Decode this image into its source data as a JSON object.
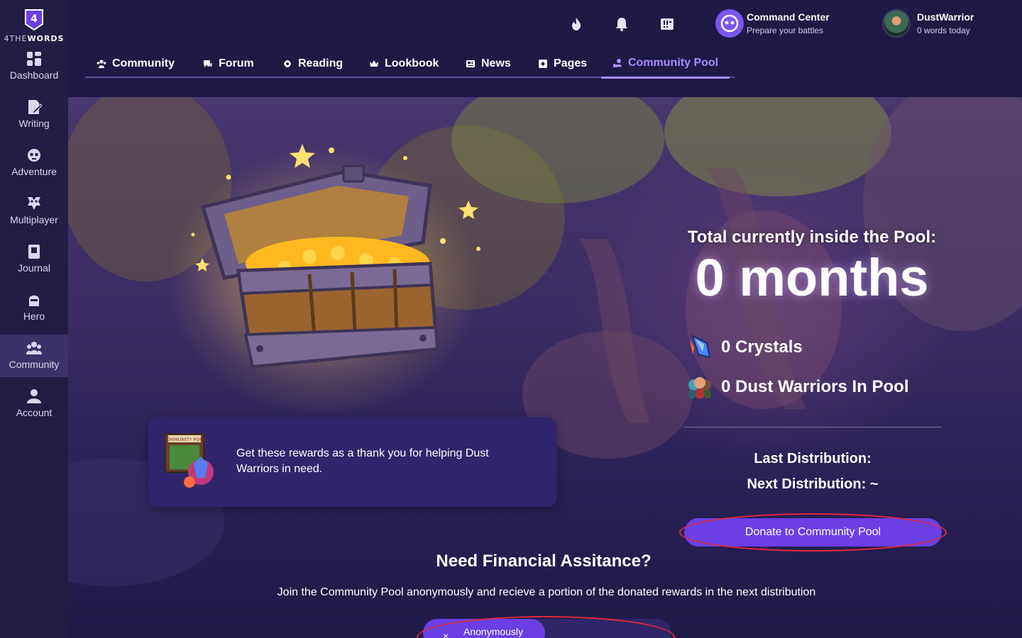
{
  "brand": {
    "name": "4THEWORDS",
    "name_prefix": "4THE",
    "name_suffix": "WORDS",
    "badge_number": "4"
  },
  "sidebar": {
    "items": [
      {
        "label": "Dashboard",
        "icon": "dashboard-icon"
      },
      {
        "label": "Writing",
        "icon": "writing-icon"
      },
      {
        "label": "Adventure",
        "icon": "adventure-icon"
      },
      {
        "label": "Multiplayer",
        "icon": "multiplayer-icon"
      },
      {
        "label": "Journal",
        "icon": "journal-icon"
      },
      {
        "label": "Hero",
        "icon": "hero-icon"
      },
      {
        "label": "Community",
        "icon": "community-icon",
        "active": true
      },
      {
        "label": "Account",
        "icon": "account-icon"
      }
    ]
  },
  "topbar": {
    "icons": [
      "streak-flame-icon",
      "notification-bell-icon",
      "alerts-board-icon"
    ],
    "command_center": {
      "title": "Command Center",
      "subtitle": "Prepare your battles"
    },
    "user": {
      "name": "DustWarrior",
      "subtitle": "0 words today"
    }
  },
  "tabs": [
    {
      "label": "Community",
      "icon": "community-icon"
    },
    {
      "label": "Forum",
      "icon": "forum-icon"
    },
    {
      "label": "Reading",
      "icon": "reading-icon"
    },
    {
      "label": "Lookbook",
      "icon": "crown-icon"
    },
    {
      "label": "News",
      "icon": "news-icon"
    },
    {
      "label": "Pages",
      "icon": "pages-icon"
    },
    {
      "label": "Community Pool",
      "icon": "community-pool-icon",
      "active": true
    }
  ],
  "pool": {
    "heading": "Total currently inside the Pool:",
    "total": "0 months",
    "crystals": "0 Crystals",
    "warriors": "0 Dust Warriors In Pool",
    "last_distribution": "Last Distribution:",
    "next_distribution": "Next Distribution: ~",
    "donate_label": "Donate to Community Pool"
  },
  "reward_card": {
    "text": "Get these rewards as a thank you for helping Dust Warriors in need.",
    "image_label": "COMMUNITY POOL"
  },
  "financial": {
    "title": "Need Financial Assitance?",
    "subtitle": "Join the Community Pool anonymously and recieve a portion of the donated rewards in the next distribution",
    "toggle_label": "Anonymously",
    "toggle_icon": "×"
  },
  "colors": {
    "accent": "#6b3fe4",
    "active_tab": "#a98cff",
    "sidebar_bg": "#221d45",
    "highlight": "#e3283a"
  }
}
